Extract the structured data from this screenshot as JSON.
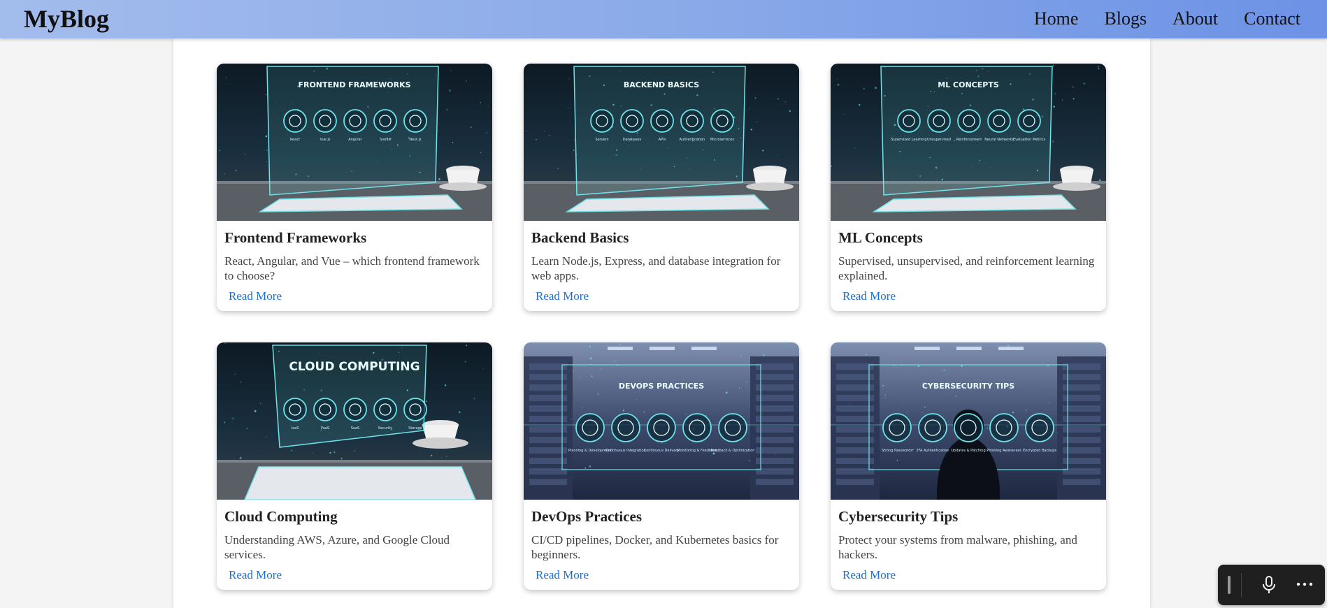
{
  "header": {
    "logo": "MyBlog",
    "nav": [
      "Home",
      "Blogs",
      "About",
      "Contact"
    ]
  },
  "posts": [
    {
      "title": "Frontend Frameworks",
      "description": "React, Angular, and Vue – which frontend framework to choose?",
      "link": "Read More",
      "image": {
        "heading": "FRONTEND FRAMEWORKS",
        "icons": [
          "React",
          "Vue.js",
          "Angular",
          "Svelte",
          "Next.js"
        ],
        "scene": "holographic-desk"
      }
    },
    {
      "title": "Backend Basics",
      "description": "Learn Node.js, Express, and database integration for web apps.",
      "link": "Read More",
      "image": {
        "heading": "BACKEND BASICS",
        "icons": [
          "Servers",
          "Databases",
          "APIs",
          "Authentication",
          "Microservices"
        ],
        "scene": "holographic-desk"
      }
    },
    {
      "title": "ML Concepts",
      "description": "Supervised, unsupervised, and reinforcement learning explained.",
      "link": "Read More",
      "image": {
        "heading": "ML CONCEPTS",
        "icons": [
          "Supervised Learning",
          "Unsupervised",
          "Reinforcement",
          "Neural Networks",
          "Evaluation Metrics"
        ],
        "scene": "holographic-desk"
      }
    },
    {
      "title": "Cloud Computing",
      "description": "Understanding AWS, Azure, and Google Cloud services.",
      "link": "Read More",
      "image": {
        "heading": "CLOUD COMPUTING",
        "icons": [
          "IaaS",
          "PaaS",
          "SaaS",
          "Security",
          "Storage"
        ],
        "scene": "holographic-desk-angled"
      }
    },
    {
      "title": "DevOps Practices",
      "description": "CI/CD pipelines, Docker, and Kubernetes basics for beginners.",
      "link": "Read More",
      "image": {
        "heading": "DEVOPS PRACTICES",
        "icons": [
          "Planning & Development",
          "Continuous Integration",
          "Continuous Delivery",
          "Monitoring & Feedback",
          "Feedback & Optimization"
        ],
        "scene": "server-room"
      }
    },
    {
      "title": "Cybersecurity Tips",
      "description": "Protect your systems from malware, phishing, and hackers.",
      "link": "Read More",
      "image": {
        "heading": "CYBERSECURITY TIPS",
        "icons": [
          "Strong Passwords",
          "2FA Authentication",
          "Updates & Patching",
          "Phishing Awareness",
          "Encrypted Backups"
        ],
        "scene": "server-room-hacker"
      }
    }
  ],
  "voice_toolbar": {
    "icons": [
      "drag-handle-icon",
      "microphone-icon",
      "more-options-icon"
    ]
  },
  "colors": {
    "header_gradient_start": "#a3bcec",
    "header_gradient_end": "#6d92e6",
    "link": "#1a6fd4",
    "hologram": "#6fe3e8"
  }
}
